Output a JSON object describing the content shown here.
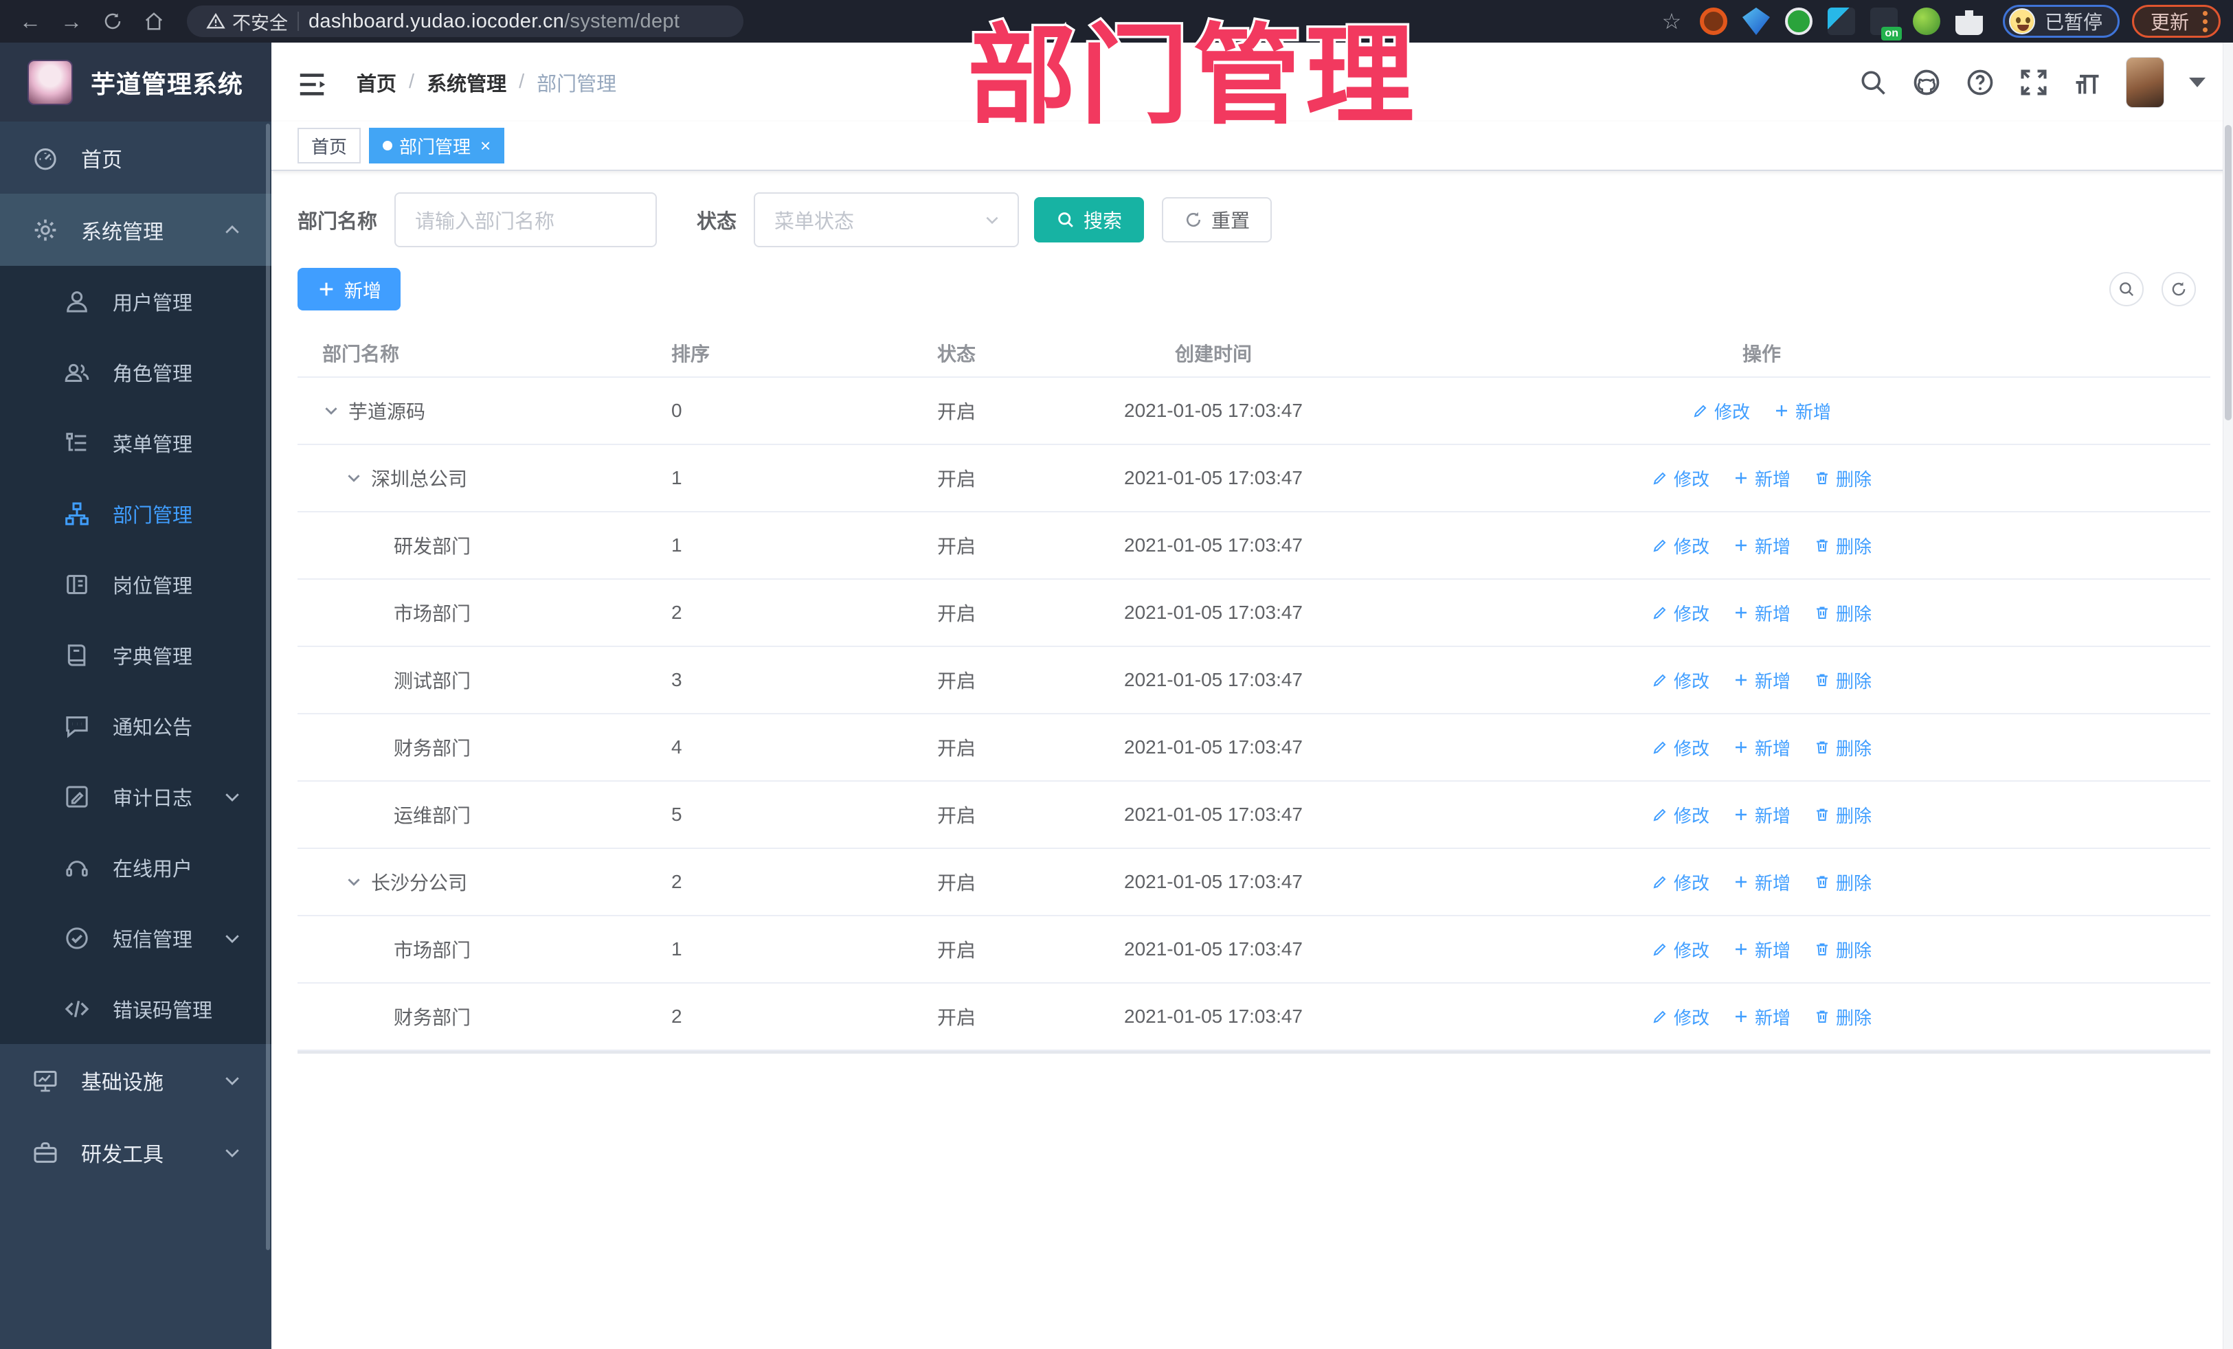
{
  "browser": {
    "security_label": "不安全",
    "url_host": "dashboard.yudao.iocoder.cn",
    "url_path": "/system/dept",
    "profile_status": "已暂停",
    "update_label": "更新"
  },
  "app": {
    "title": "芋道管理系统"
  },
  "overlay": {
    "text": "部门管理"
  },
  "breadcrumb": {
    "items": [
      "首页",
      "系统管理",
      "部门管理"
    ]
  },
  "tabs": [
    {
      "label": "首页",
      "active": false,
      "closable": false
    },
    {
      "label": "部门管理",
      "active": true,
      "closable": true
    }
  ],
  "sidebar": {
    "items": [
      {
        "label": "首页",
        "icon": "dashboard-icon",
        "kind": "top"
      },
      {
        "label": "系统管理",
        "icon": "gear-icon",
        "kind": "group-open",
        "chevron": "up"
      },
      {
        "label": "用户管理",
        "icon": "user-icon",
        "kind": "sub"
      },
      {
        "label": "角色管理",
        "icon": "users-icon",
        "kind": "sub"
      },
      {
        "label": "菜单管理",
        "icon": "menu-tree-icon",
        "kind": "sub"
      },
      {
        "label": "部门管理",
        "icon": "org-tree-icon",
        "kind": "sub",
        "active": true
      },
      {
        "label": "岗位管理",
        "icon": "badge-icon",
        "kind": "sub"
      },
      {
        "label": "字典管理",
        "icon": "dict-icon",
        "kind": "sub"
      },
      {
        "label": "通知公告",
        "icon": "announcement-icon",
        "kind": "sub"
      },
      {
        "label": "审计日志",
        "icon": "audit-log-icon",
        "kind": "sub",
        "chevron": "down"
      },
      {
        "label": "在线用户",
        "icon": "online-user-icon",
        "kind": "sub"
      },
      {
        "label": "短信管理",
        "icon": "sms-icon",
        "kind": "sub",
        "chevron": "down"
      },
      {
        "label": "错误码管理",
        "icon": "error-code-icon",
        "kind": "sub"
      },
      {
        "label": "基础设施",
        "icon": "infrastructure-icon",
        "kind": "top",
        "chevron": "down"
      },
      {
        "label": "研发工具",
        "icon": "dev-tools-icon",
        "kind": "top",
        "chevron": "down"
      }
    ]
  },
  "filter": {
    "dept_label": "部门名称",
    "dept_placeholder": "请输入部门名称",
    "status_label": "状态",
    "status_placeholder": "菜单状态",
    "search_label": "搜索",
    "reset_label": "重置"
  },
  "toolbar": {
    "add_label": "新增"
  },
  "table": {
    "columns": [
      "部门名称",
      "排序",
      "状态",
      "创建时间",
      "操作"
    ],
    "action_labels": {
      "edit": "修改",
      "add": "新增",
      "delete": "删除"
    },
    "rows": [
      {
        "name": "芋道源码",
        "level": 0,
        "expandable": true,
        "sort": "0",
        "status": "开启",
        "created": "2021-01-05 17:03:47",
        "actions": [
          "edit",
          "add"
        ]
      },
      {
        "name": "深圳总公司",
        "level": 1,
        "expandable": true,
        "sort": "1",
        "status": "开启",
        "created": "2021-01-05 17:03:47",
        "actions": [
          "edit",
          "add",
          "delete"
        ]
      },
      {
        "name": "研发部门",
        "level": 2,
        "expandable": false,
        "sort": "1",
        "status": "开启",
        "created": "2021-01-05 17:03:47",
        "actions": [
          "edit",
          "add",
          "delete"
        ]
      },
      {
        "name": "市场部门",
        "level": 2,
        "expandable": false,
        "sort": "2",
        "status": "开启",
        "created": "2021-01-05 17:03:47",
        "actions": [
          "edit",
          "add",
          "delete"
        ]
      },
      {
        "name": "测试部门",
        "level": 2,
        "expandable": false,
        "sort": "3",
        "status": "开启",
        "created": "2021-01-05 17:03:47",
        "actions": [
          "edit",
          "add",
          "delete"
        ]
      },
      {
        "name": "财务部门",
        "level": 2,
        "expandable": false,
        "sort": "4",
        "status": "开启",
        "created": "2021-01-05 17:03:47",
        "actions": [
          "edit",
          "add",
          "delete"
        ]
      },
      {
        "name": "运维部门",
        "level": 2,
        "expandable": false,
        "sort": "5",
        "status": "开启",
        "created": "2021-01-05 17:03:47",
        "actions": [
          "edit",
          "add",
          "delete"
        ]
      },
      {
        "name": "长沙分公司",
        "level": 1,
        "expandable": true,
        "sort": "2",
        "status": "开启",
        "created": "2021-01-05 17:03:47",
        "actions": [
          "edit",
          "add",
          "delete"
        ]
      },
      {
        "name": "市场部门",
        "level": 2,
        "expandable": false,
        "sort": "1",
        "status": "开启",
        "created": "2021-01-05 17:03:47",
        "actions": [
          "edit",
          "add",
          "delete"
        ]
      },
      {
        "name": "财务部门",
        "level": 2,
        "expandable": false,
        "sort": "2",
        "status": "开启",
        "created": "2021-01-05 17:03:47",
        "actions": [
          "edit",
          "add",
          "delete"
        ]
      }
    ]
  },
  "colors": {
    "accent_blue": "#409eff",
    "active_tab": "#42a5f5",
    "teal_button": "#17b3a3",
    "sidebar_bg": "#304156",
    "submenu_bg": "#1f2d3d",
    "overlay_pink": "#f2395f"
  }
}
